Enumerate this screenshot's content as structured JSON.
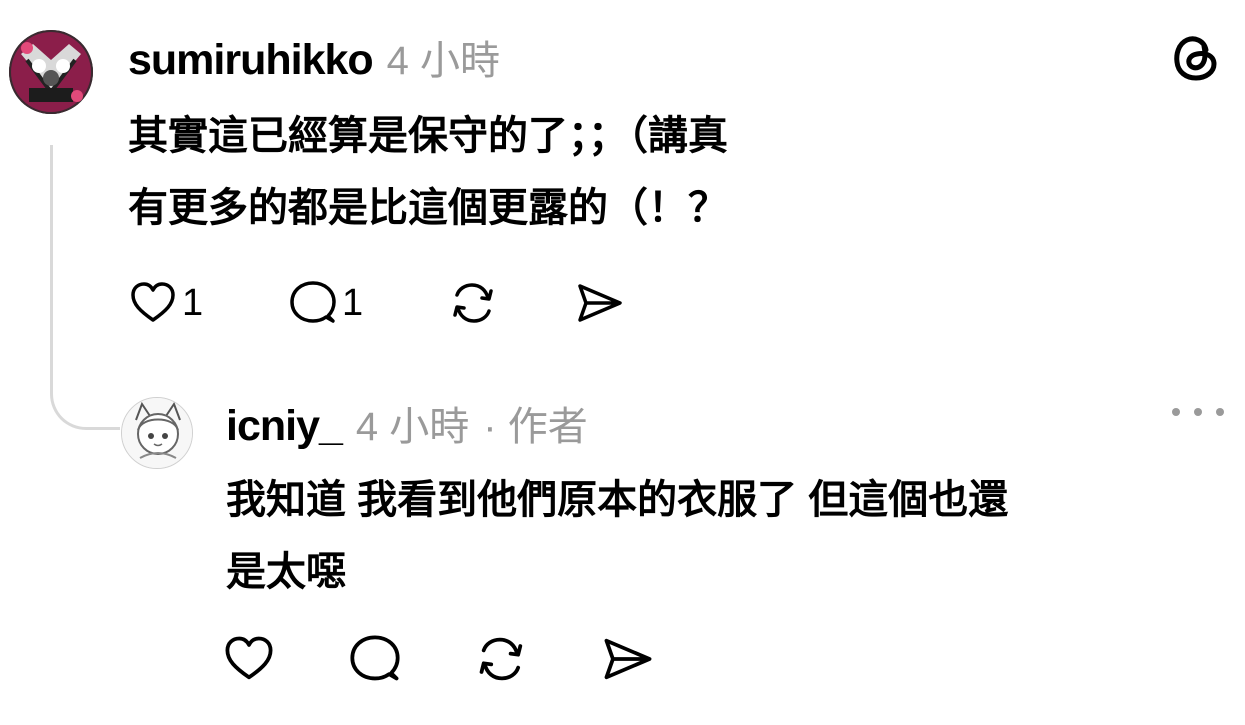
{
  "app": {
    "logo_icon": "threads-logo-icon"
  },
  "colors": {
    "text": "#000000",
    "muted": "#9a9a9a",
    "thread_line": "#d9d9d9"
  },
  "post": {
    "username": "sumiruhikko",
    "time": "4 小時",
    "avatar_icon": "avatar",
    "lines": [
      "其實這已經算是保守的了；；（講真",
      "有更多的都是比這個更露的（！？"
    ],
    "actions": {
      "like_icon": "heart-icon",
      "like_count": "1",
      "reply_icon": "comment-icon",
      "reply_count": "1",
      "repost_icon": "repost-icon",
      "share_icon": "send-icon"
    }
  },
  "reply": {
    "username": "icniy_",
    "time": "4 小時",
    "author_badge": "· 作者",
    "avatar_icon": "avatar",
    "more_icon": "more-icon",
    "lines": [
      "我知道 我看到他們原本的衣服了 但這個也還",
      "是太噁"
    ],
    "actions": {
      "like_icon": "heart-icon",
      "reply_icon": "comment-icon",
      "repost_icon": "repost-icon",
      "share_icon": "send-icon"
    }
  }
}
